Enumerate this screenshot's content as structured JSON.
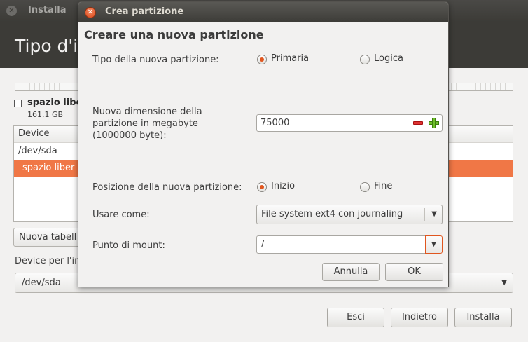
{
  "background_window": {
    "title": "Installa",
    "header_title": "Tipo d'in",
    "legend": {
      "label": "spazio libe",
      "size": "161.1 GB"
    },
    "table": {
      "column_header": "Device",
      "rows": [
        {
          "device": "/dev/sda",
          "selected": false
        },
        {
          "device": "spazio liber",
          "selected": true
        }
      ]
    },
    "new_table_button": "Nuova tabell",
    "bootloader_label": "Device per l'in",
    "bootloader_device": "/dev/sda",
    "buttons": {
      "quit": "Esci",
      "back": "Indietro",
      "install": "Installa"
    }
  },
  "dialog": {
    "title": "Crea partizione",
    "heading": "Creare una nuova partizione",
    "type": {
      "label": "Tipo della nuova partizione:",
      "options": [
        {
          "label": "Primaria",
          "selected": true
        },
        {
          "label": "Logica",
          "selected": false
        }
      ]
    },
    "size": {
      "label_line1": "Nuova dimensione della",
      "label_line2": "partizione in megabyte",
      "label_line3": "(1000000 byte):",
      "value": "75000"
    },
    "position": {
      "label": "Posizione della nuova partizione:",
      "options": [
        {
          "label": "Inizio",
          "selected": true
        },
        {
          "label": "Fine",
          "selected": false
        }
      ]
    },
    "use_as": {
      "label": "Usare come:",
      "value": "File system ext4 con journaling"
    },
    "mount_point": {
      "label": "Punto di mount:",
      "value": "/"
    },
    "buttons": {
      "cancel": "Annulla",
      "ok": "OK"
    }
  },
  "colors": {
    "accent": "#f07746",
    "radio_dot": "#e0561f",
    "titlebar": "#3c3b37"
  }
}
